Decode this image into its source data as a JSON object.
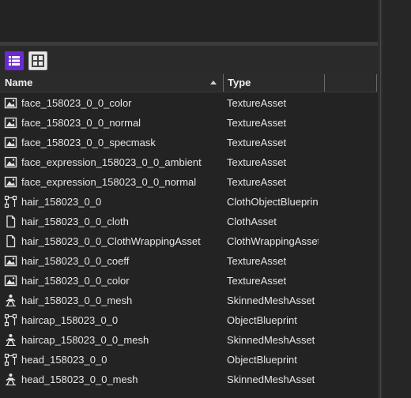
{
  "toolbar": {
    "list_view_icon": "list-view-icon",
    "grid_view_icon": "grid-view-icon",
    "accent_color": "#6a2bd0"
  },
  "columns": {
    "name": "Name",
    "type": "Type",
    "sort": "ascending"
  },
  "rows": [
    {
      "name": "face_158023_0_0_color",
      "type": "TextureAsset",
      "icon": "image"
    },
    {
      "name": "face_158023_0_0_normal",
      "type": "TextureAsset",
      "icon": "image"
    },
    {
      "name": "face_158023_0_0_specmask",
      "type": "TextureAsset",
      "icon": "image"
    },
    {
      "name": "face_expression_158023_0_0_ambient",
      "type": "TextureAsset",
      "icon": "image"
    },
    {
      "name": "face_expression_158023_0_0_normal",
      "type": "TextureAsset",
      "icon": "image"
    },
    {
      "name": "hair_158023_0_0",
      "type": "ClothObjectBlueprint",
      "icon": "blueprint"
    },
    {
      "name": "hair_158023_0_0_cloth",
      "type": "ClothAsset",
      "icon": "file"
    },
    {
      "name": "hair_158023_0_0_ClothWrappingAsset",
      "type": "ClothWrappingAsset",
      "icon": "file"
    },
    {
      "name": "hair_158023_0_0_coeff",
      "type": "TextureAsset",
      "icon": "image"
    },
    {
      "name": "hair_158023_0_0_color",
      "type": "TextureAsset",
      "icon": "image"
    },
    {
      "name": "hair_158023_0_0_mesh",
      "type": "SkinnedMeshAsset",
      "icon": "mesh"
    },
    {
      "name": "haircap_158023_0_0",
      "type": "ObjectBlueprint",
      "icon": "blueprint"
    },
    {
      "name": "haircap_158023_0_0_mesh",
      "type": "SkinnedMeshAsset",
      "icon": "mesh"
    },
    {
      "name": "head_158023_0_0",
      "type": "ObjectBlueprint",
      "icon": "blueprint"
    },
    {
      "name": "head_158023_0_0_mesh",
      "type": "SkinnedMeshAsset",
      "icon": "mesh"
    }
  ]
}
